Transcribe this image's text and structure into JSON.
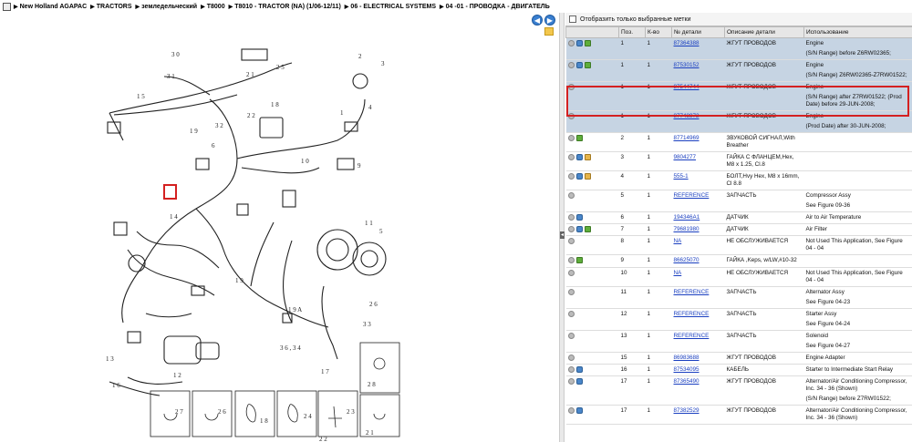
{
  "breadcrumb": [
    "New Holland AGAPAC",
    "TRACTORS",
    "земледельческий",
    "T8000",
    "T8010 - TRACTOR (NA) (1/06-12/11)",
    "06 - ELECTRICAL SYSTEMS",
    "04 -01 - ПРОВОДКА - ДВИГАТЕЛЬ"
  ],
  "filter_label": "Отобразить только выбранные метки",
  "columns": [
    "",
    "Поз.",
    "К-во",
    "№ детали",
    "Описание детали",
    "Использование"
  ],
  "rows": [
    {
      "icons": [
        "gray",
        "blue",
        "green"
      ],
      "pos": "1",
      "qty": "1",
      "part": "87364388",
      "desc": "ЖГУТ ПРОВОДОВ",
      "use": [
        "Engine",
        "(S/N Range) before Z6RW02365;"
      ],
      "sel": true
    },
    {
      "icons": [
        "gray",
        "blue",
        "green"
      ],
      "pos": "1",
      "qty": "1",
      "part": "87530152",
      "desc": "ЖГУТ ПРОВОДОВ",
      "use": [
        "Engine",
        "(S/N Range) Z6RW02365-Z7RW01522;"
      ],
      "sel": true
    },
    {
      "icons": [
        "gray"
      ],
      "pos": "1",
      "qty": "1",
      "part": "87544744",
      "desc": "ЖГУТ ПРОВОДОВ",
      "use": [
        "Engine",
        "(S/N Range) after Z7RW01522; (Prod Date) before 29-JUN-2008;"
      ],
      "sel": true
    },
    {
      "icons": [
        "gray"
      ],
      "pos": "1",
      "qty": "1",
      "part": "87748972",
      "desc": "ЖГУТ ПРОВОДОВ",
      "use": [
        "Engine",
        "(Prod Date) after 30-JUN-2008;"
      ],
      "sel": true
    },
    {
      "icons": [
        "gray",
        "green"
      ],
      "pos": "2",
      "qty": "1",
      "part": "87714969",
      "desc": "ЗВУКОВОЙ СИГНАЛ,With Breather",
      "use": [
        ""
      ],
      "sel": false
    },
    {
      "icons": [
        "gray",
        "blue",
        "box"
      ],
      "pos": "3",
      "qty": "1",
      "part": "9804277",
      "desc": "ГАЙКА С ФЛАНЦЕМ,Hex, M8 x 1.25, Cl.8",
      "use": [
        ""
      ],
      "sel": false
    },
    {
      "icons": [
        "gray",
        "blue",
        "box"
      ],
      "pos": "4",
      "qty": "1",
      "part": "555-1",
      "desc": "БОЛТ,Hvy Hex, M8 x 16mm, Cl 8.8",
      "use": [
        ""
      ],
      "sel": false
    },
    {
      "icons": [
        "gray"
      ],
      "pos": "5",
      "qty": "1",
      "part": "REFERENCE",
      "desc": "ЗАПЧАСТЬ",
      "use": [
        "Compressor Assy",
        "See Figure 09-36"
      ],
      "sel": false
    },
    {
      "icons": [
        "gray",
        "blue"
      ],
      "pos": "6",
      "qty": "1",
      "part": "194346A1",
      "desc": "ДАТЧИК",
      "use": [
        "Air to Air Temperature"
      ],
      "sel": false
    },
    {
      "icons": [
        "gray",
        "blue",
        "green"
      ],
      "pos": "7",
      "qty": "1",
      "part": "79681980",
      "desc": "ДАТЧИК",
      "use": [
        "Air Filter"
      ],
      "sel": false
    },
    {
      "icons": [
        "gray"
      ],
      "pos": "8",
      "qty": "1",
      "part": "NA",
      "desc": "НЕ ОБСЛУЖИВАЕТСЯ",
      "use": [
        "Not Used This Application, See Figure 04 - 04"
      ],
      "sel": false
    },
    {
      "icons": [
        "gray",
        "green"
      ],
      "pos": "9",
      "qty": "1",
      "part": "86625070",
      "desc": "ГАЙКА ,Keps, w/LW,#10-32",
      "use": [
        ""
      ],
      "sel": false
    },
    {
      "icons": [
        "gray"
      ],
      "pos": "10",
      "qty": "1",
      "part": "NA",
      "desc": "НЕ ОБСЛУЖИВАЕТСЯ",
      "use": [
        "Not Used This Application, See Figure 04 - 04"
      ],
      "sel": false
    },
    {
      "icons": [
        "gray"
      ],
      "pos": "11",
      "qty": "1",
      "part": "REFERENCE",
      "desc": "ЗАПЧАСТЬ",
      "use": [
        "Alternator Assy",
        "See Figure 04-23"
      ],
      "sel": false
    },
    {
      "icons": [
        "gray"
      ],
      "pos": "12",
      "qty": "1",
      "part": "REFERENCE",
      "desc": "ЗАПЧАСТЬ",
      "use": [
        "Starter Assy",
        "See Figure 04-24"
      ],
      "sel": false
    },
    {
      "icons": [
        "gray"
      ],
      "pos": "13",
      "qty": "1",
      "part": "REFERENCE",
      "desc": "ЗАПЧАСТЬ",
      "use": [
        "Solenoid",
        "See Figure 04-27"
      ],
      "sel": false
    },
    {
      "icons": [
        "gray"
      ],
      "pos": "15",
      "qty": "1",
      "part": "86983688",
      "desc": "ЖГУТ ПРОВОДОВ",
      "use": [
        "Engine Adapter"
      ],
      "sel": false
    },
    {
      "icons": [
        "gray",
        "blue"
      ],
      "pos": "16",
      "qty": "1",
      "part": "87534095",
      "desc": "КАБЕЛЬ",
      "use": [
        "Starter to Intermediate Start Relay"
      ],
      "sel": false
    },
    {
      "icons": [
        "gray",
        "blue"
      ],
      "pos": "17",
      "qty": "1",
      "part": "87365490",
      "desc": "ЖГУТ ПРОВОДОВ",
      "use": [
        "Alternator/Air Conditioning Compressor, Inc. 34 - 36 (Shown)",
        "(S/N Range) before Z7RW01522;"
      ],
      "sel": false
    },
    {
      "icons": [
        "gray",
        "blue"
      ],
      "pos": "17",
      "qty": "1",
      "part": "87382529",
      "desc": "ЖГУТ ПРОВОДОВ",
      "use": [
        "Alternator/Air Conditioning Compressor, Inc. 34 - 36 (Shown)"
      ],
      "sel": false
    }
  ],
  "callouts": [
    "30",
    "25",
    "2",
    "3",
    "31",
    "15",
    "21",
    "18",
    "4",
    "32",
    "22",
    "1",
    "19",
    "6",
    "9",
    "10",
    "11",
    "5",
    "14",
    "19A",
    "26",
    "33",
    "34",
    "36",
    "17",
    "13",
    "8",
    "16",
    "12",
    "28",
    "27",
    "26",
    "18",
    "24",
    "23",
    "22",
    "21"
  ],
  "nav": {
    "back": "◀",
    "forward": "▶"
  }
}
